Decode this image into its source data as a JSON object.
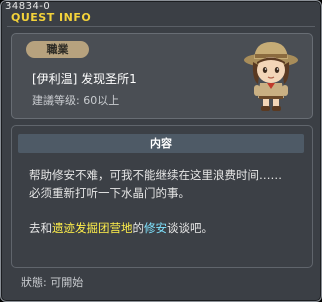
{
  "header": {
    "quest_id": "34834-0",
    "title": "QUEST INFO"
  },
  "quest": {
    "category": "職業",
    "name": "[伊利温] 发现圣所1",
    "recommend": "建議等级: 60以上"
  },
  "content": {
    "header": "内容",
    "line1": "帮助修安不难，可我不能继续在这里浪费时间……",
    "line2": "必须重新打听一下水晶门的事。",
    "p2_prefix": "去和",
    "p2_place": "遗迹发掘团营地",
    "p2_mid": "的",
    "p2_npc": "修安",
    "p2_suffix": "谈谈吧。"
  },
  "status": "狀態: 可開始",
  "colors": {
    "title": "#f3d23a",
    "place": "#ffef4a",
    "npc": "#7fe3ff"
  }
}
